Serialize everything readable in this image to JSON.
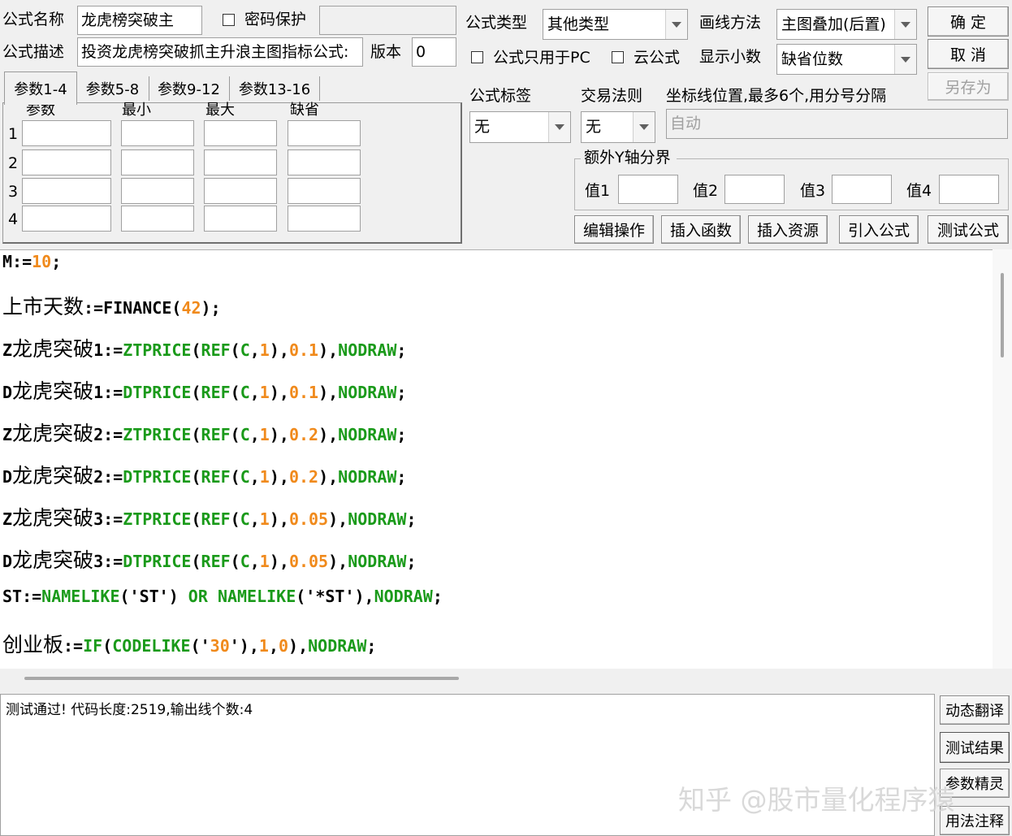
{
  "form": {
    "name_label": "公式名称",
    "name_value": "龙虎榜突破主",
    "password_label": "密码保护",
    "password_value": "",
    "desc_label": "公式描述",
    "desc_value": "投资龙虎榜突破抓主升浪主图指标公式:",
    "version_label": "版本",
    "version_value": "0",
    "type_label": "公式类型",
    "type_value": "其他类型",
    "draw_label": "画线方法",
    "draw_value": "主图叠加(后置)",
    "pc_only_label": "公式只用于PC",
    "cloud_label": "云公式",
    "decimal_label": "显示小数",
    "decimal_value": "缺省位数",
    "tag_label": "公式标签",
    "tag_value": "无",
    "trade_label": "交易法则",
    "trade_value": "无",
    "coord_label": "坐标线位置,最多6个,用分号分隔",
    "coord_value": "自动",
    "yaxis_group_label": "额外Y轴分界",
    "y_values": [
      {
        "label": "值1",
        "value": ""
      },
      {
        "label": "值2",
        "value": ""
      },
      {
        "label": "值3",
        "value": ""
      },
      {
        "label": "值4",
        "value": ""
      }
    ]
  },
  "buttons": {
    "ok": "确  定",
    "cancel": "取  消",
    "save_as": "另存为",
    "edit": "编辑操作",
    "insert_func": "插入函数",
    "insert_res": "插入资源",
    "import": "引入公式",
    "test": "测试公式",
    "dyn_translate": "动态翻译",
    "test_result": "测试结果",
    "param_wizard": "参数精灵",
    "usage": "用法注释"
  },
  "param_tabs": [
    "参数1-4",
    "参数5-8",
    "参数9-12",
    "参数13-16"
  ],
  "param_headers": [
    "参数",
    "最小",
    "最大",
    "缺省"
  ],
  "param_rows": [
    "1",
    "2",
    "3",
    "4"
  ],
  "code_lines": [
    "M:=10;",
    "上市天数:=FINANCE(42);",
    "Z龙虎突破1:=ZTPRICE(REF(C,1),0.1),NODRAW;",
    "D龙虎突破1:=DTPRICE(REF(C,1),0.1),NODRAW;",
    "Z龙虎突破2:=ZTPRICE(REF(C,1),0.2),NODRAW;",
    "D龙虎突破2:=DTPRICE(REF(C,1),0.2),NODRAW;",
    "Z龙虎突破3:=ZTPRICE(REF(C,1),0.05),NODRAW;",
    "D龙虎突破3:=DTPRICE(REF(C,1),0.05),NODRAW;",
    "ST:=NAMELIKE('ST') OR NAMELIKE('*ST'),NODRAW;",
    "创业板:=IF(CODELIKE('30'),1,0),NODRAW;"
  ],
  "output_text": "测试通过! 代码长度:2519,输出线个数:4",
  "watermark": "知乎 @股市量化程序猿",
  "colors": {
    "func": "#1a9a1a",
    "number": "#f08a1c"
  }
}
